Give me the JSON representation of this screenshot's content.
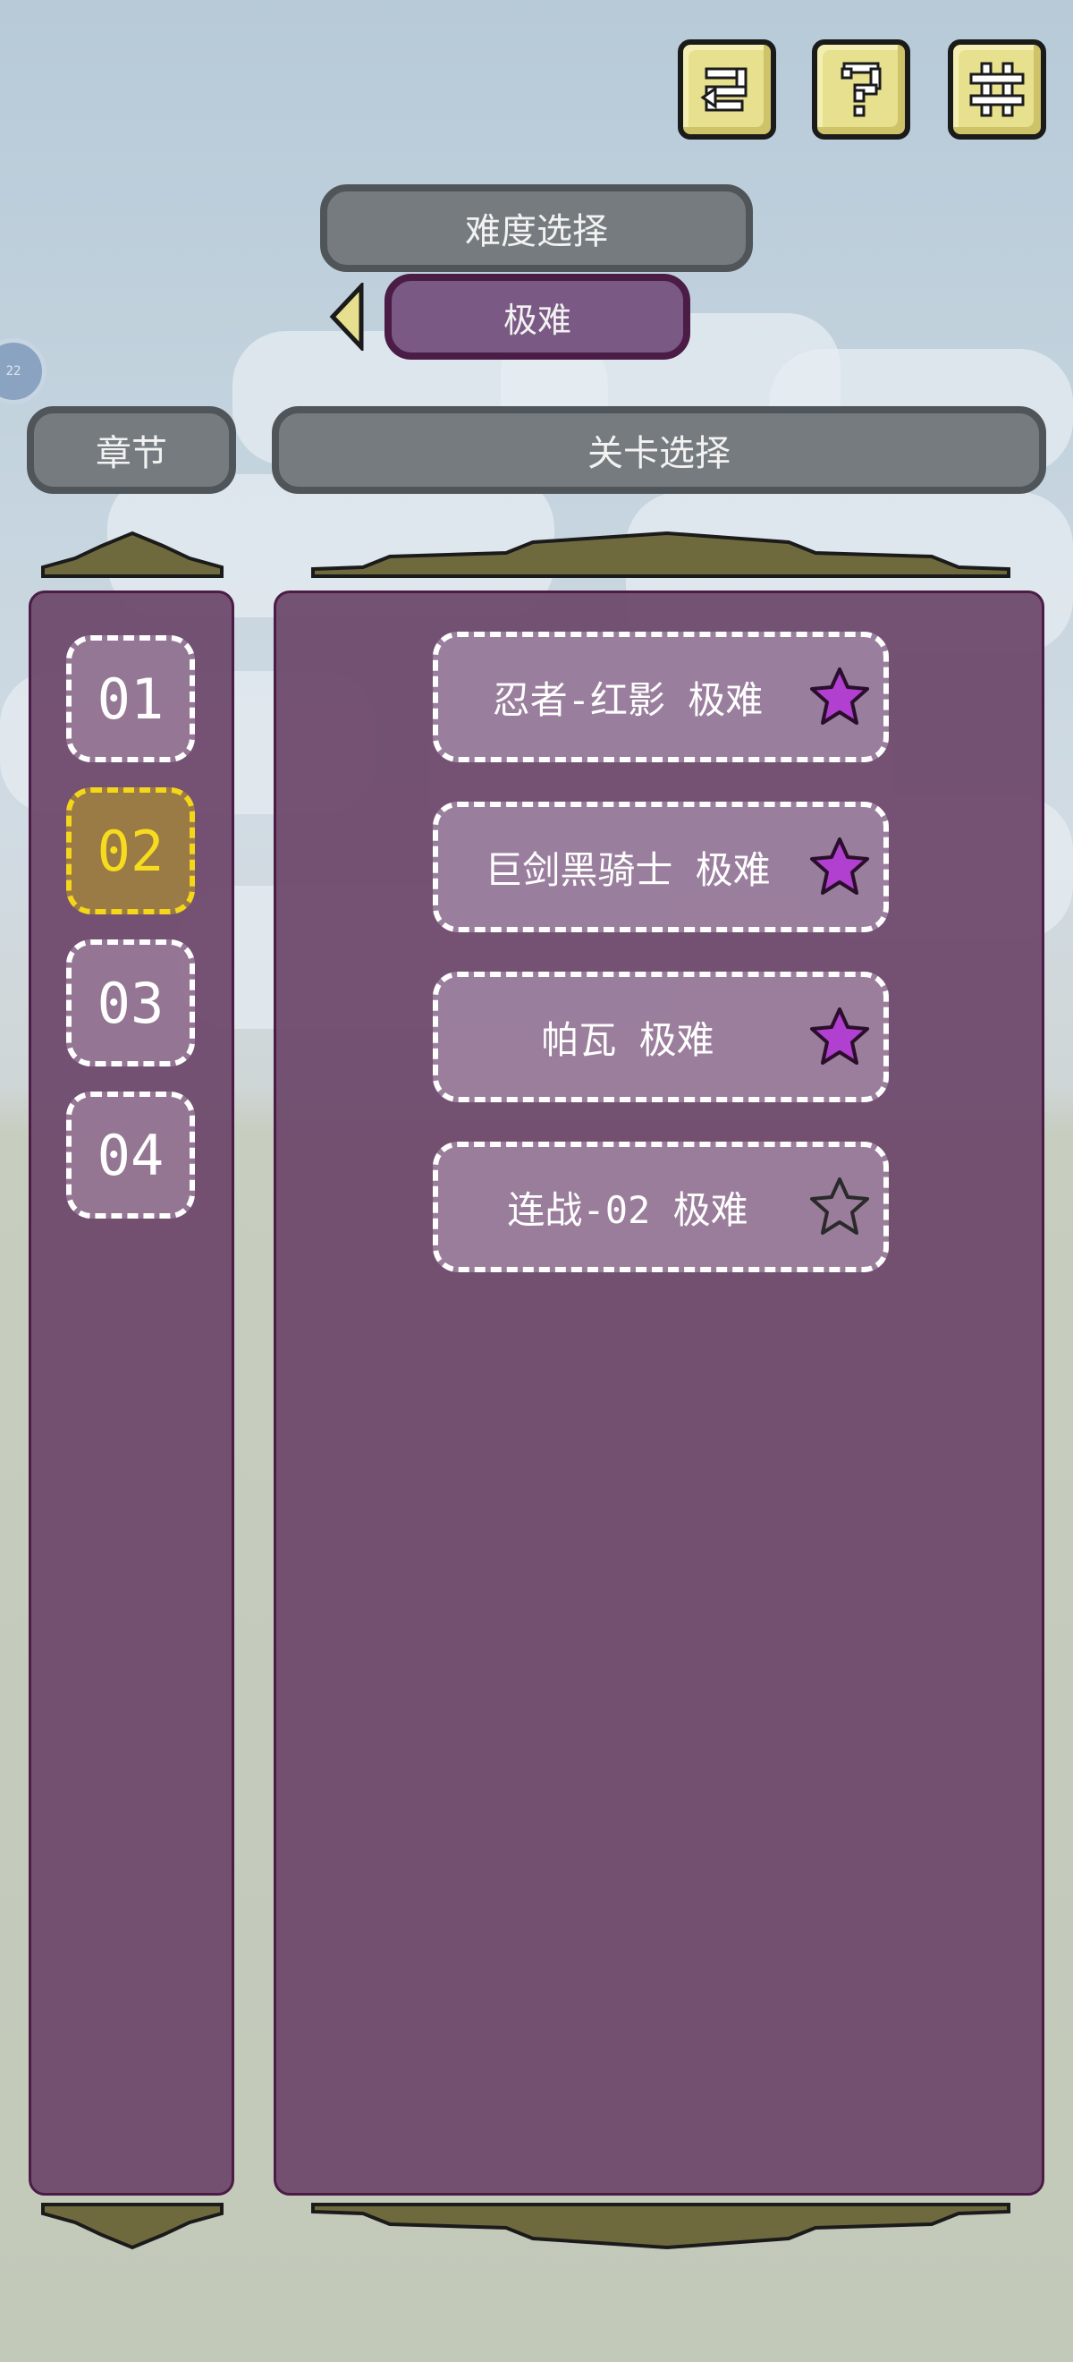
{
  "top_buttons": [
    {
      "icon": "refresh-icon"
    },
    {
      "icon": "help-icon"
    },
    {
      "icon": "settings-icon"
    }
  ],
  "difficulty": {
    "title": "难度选择",
    "current": "极难"
  },
  "chapters": {
    "title": "章节",
    "items": [
      "01",
      "02",
      "03",
      "04"
    ],
    "selected": "02"
  },
  "levels": {
    "title": "关卡选择",
    "items": [
      {
        "label": "忍者-红影 极难",
        "star": "filled"
      },
      {
        "label": "巨剑黑骑士 极难",
        "star": "filled"
      },
      {
        "label": "帕瓦 极难",
        "star": "filled"
      },
      {
        "label": "连战-02 极难",
        "star": "empty"
      }
    ]
  },
  "edge_badge": {
    "text": "22"
  },
  "colors": {
    "panel": "#6d486b",
    "star_filled": "#b13fd0",
    "selected": "#f4d61a",
    "button_yellow": "#e7e08e"
  }
}
